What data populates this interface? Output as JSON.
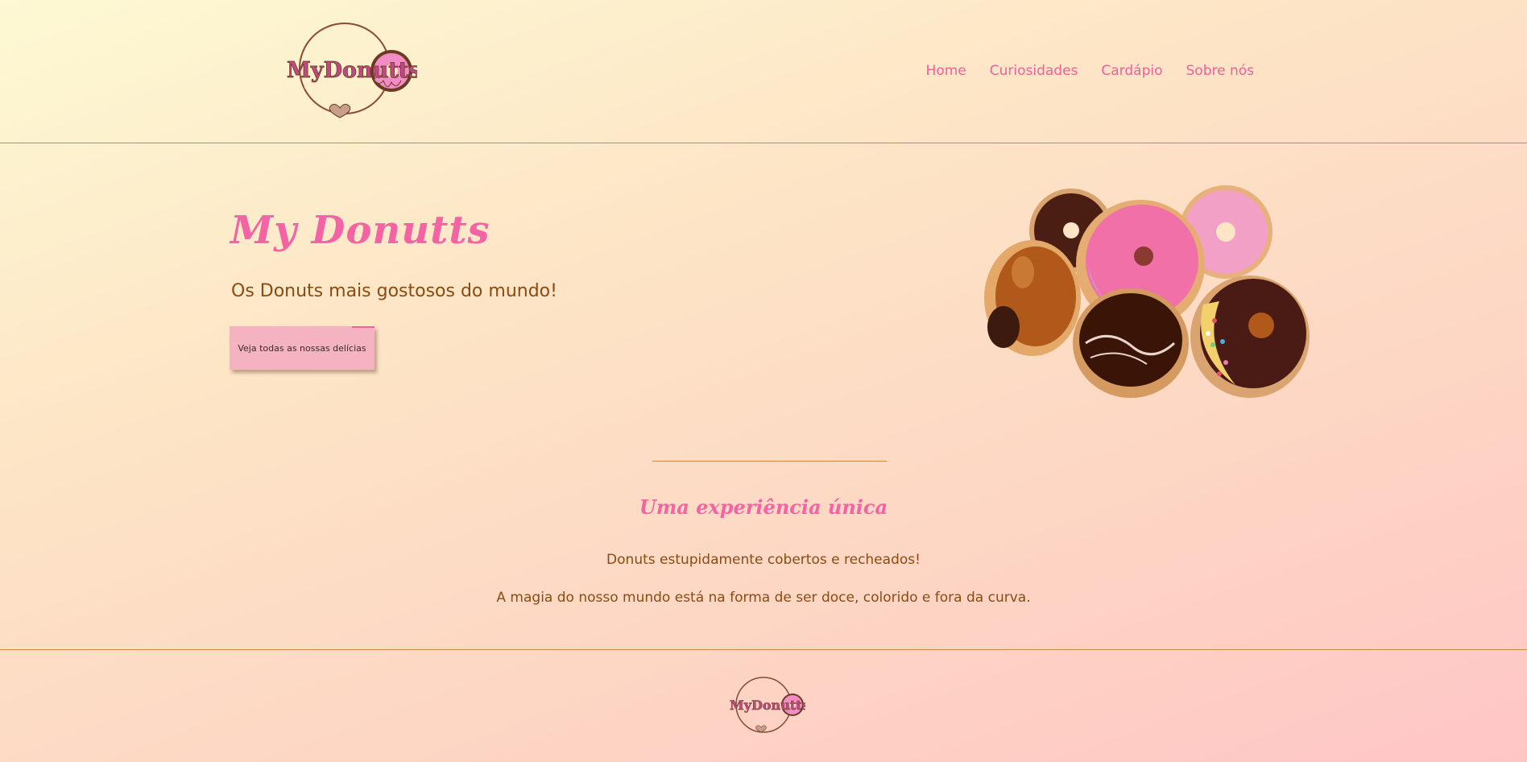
{
  "header": {
    "logo_text": "MyDonutts",
    "nav": [
      {
        "label": "Home"
      },
      {
        "label": "Curiosidades"
      },
      {
        "label": "Cardápio"
      },
      {
        "label": "Sobre nós"
      }
    ]
  },
  "hero": {
    "title": "My Donutts",
    "subtitle": "Os Donuts mais gostosos do mundo!",
    "button_label": "Veja todas as nossas delícias",
    "image": "donuts-pile-image"
  },
  "experience": {
    "title": "Uma experiência única",
    "line1": "Donuts estupidamente cobertos e recheados!",
    "line2": "A magia do nosso mundo está na forma de ser doce, colorido e fora da curva."
  },
  "footer": {
    "logo_text": "MyDonutts"
  },
  "colors": {
    "accent_pink": "#f463a3",
    "text_brown": "#8a4b12",
    "button_bg": "#f5b3c2",
    "divider": "#c98a48"
  }
}
